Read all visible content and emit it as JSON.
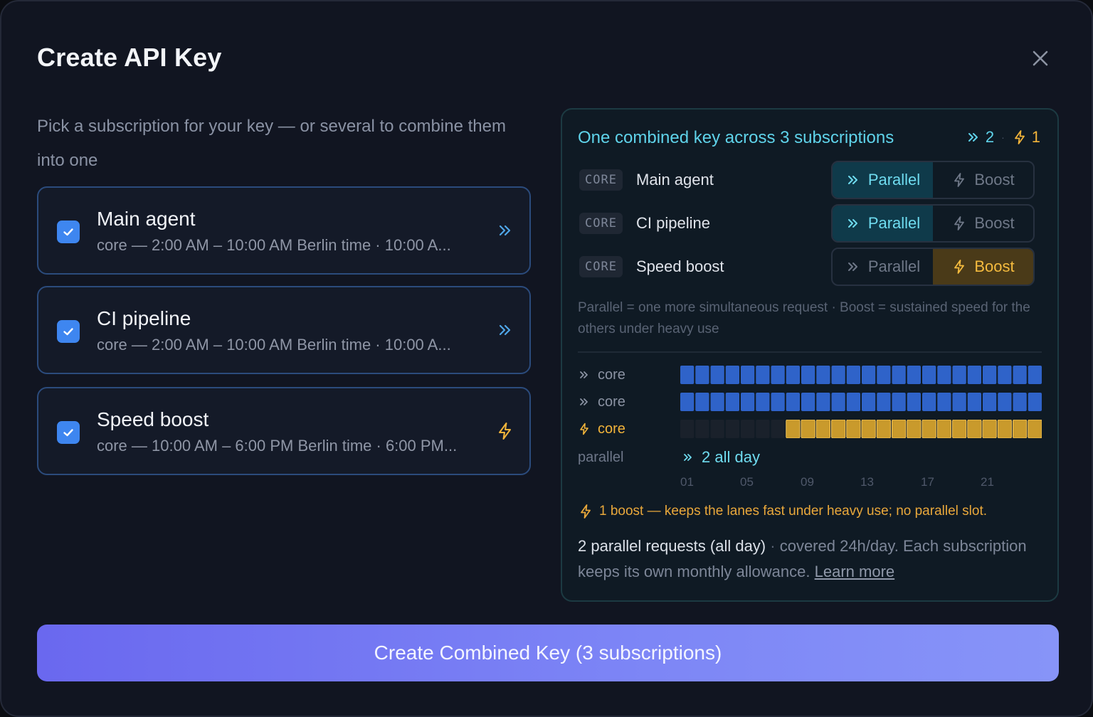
{
  "modal": {
    "title": "Create API Key",
    "close_icon": "close-icon"
  },
  "intro": "Pick a subscription for your key — or several to combine them into one",
  "subscriptions": [
    {
      "name": "Main agent",
      "desc": "core — 2:00 AM – 10:00 AM Berlin time · 10:00 A...",
      "checked": true,
      "icon": "parallel-chevrons-icon"
    },
    {
      "name": "CI pipeline",
      "desc": "core — 2:00 AM – 10:00 AM Berlin time · 10:00 A...",
      "checked": true,
      "icon": "parallel-chevrons-icon"
    },
    {
      "name": "Speed boost",
      "desc": "core — 10:00 AM – 6:00 PM Berlin time · 6:00 PM...",
      "checked": true,
      "icon": "lightning-bolt-icon"
    }
  ],
  "panel": {
    "title": "One combined key across 3 subscriptions",
    "parallel_count": "2",
    "count_separator": "·",
    "boost_count": "1",
    "rows": [
      {
        "tag": "CORE",
        "name": "Main agent",
        "parallel_label": "Parallel",
        "boost_label": "Boost",
        "mode": "parallel"
      },
      {
        "tag": "CORE",
        "name": "CI pipeline",
        "parallel_label": "Parallel",
        "boost_label": "Boost",
        "mode": "parallel"
      },
      {
        "tag": "CORE",
        "name": "Speed boost",
        "parallel_label": "Parallel",
        "boost_label": "Boost",
        "mode": "boost"
      }
    ],
    "legend": "Parallel = one more simultaneous request · Boost = sustained speed for the others under heavy use",
    "lanes": [
      {
        "label": "core",
        "kind": "parallel",
        "active_hours": [
          0,
          24
        ]
      },
      {
        "label": "core",
        "kind": "parallel",
        "active_hours": [
          0,
          24
        ]
      },
      {
        "label": "core",
        "kind": "boost",
        "active_hours": [
          7,
          24
        ]
      }
    ],
    "parallel_row": {
      "label": "parallel",
      "value": "2 all day"
    },
    "hour_ticks": [
      "01",
      "05",
      "09",
      "13",
      "17",
      "21"
    ],
    "boost_note": "1 boost — keeps the lanes fast under heavy use; no parallel slot.",
    "summary": {
      "strong": "2 parallel requests (all day)",
      "sep": " · ",
      "rest": "covered 24h/day. Each subscription keeps its own monthly allowance. ",
      "link": "Learn more"
    }
  },
  "create_button": "Create Combined Key (3 subscriptions)",
  "colors": {
    "accent_parallel": "#5fd3ea",
    "accent_boost": "#f2b43a",
    "checkbox": "#3e86f0",
    "lane_parallel": "#2f63c9",
    "lane_boost": "#c99a2c",
    "lane_inactive": "#1a212b"
  }
}
